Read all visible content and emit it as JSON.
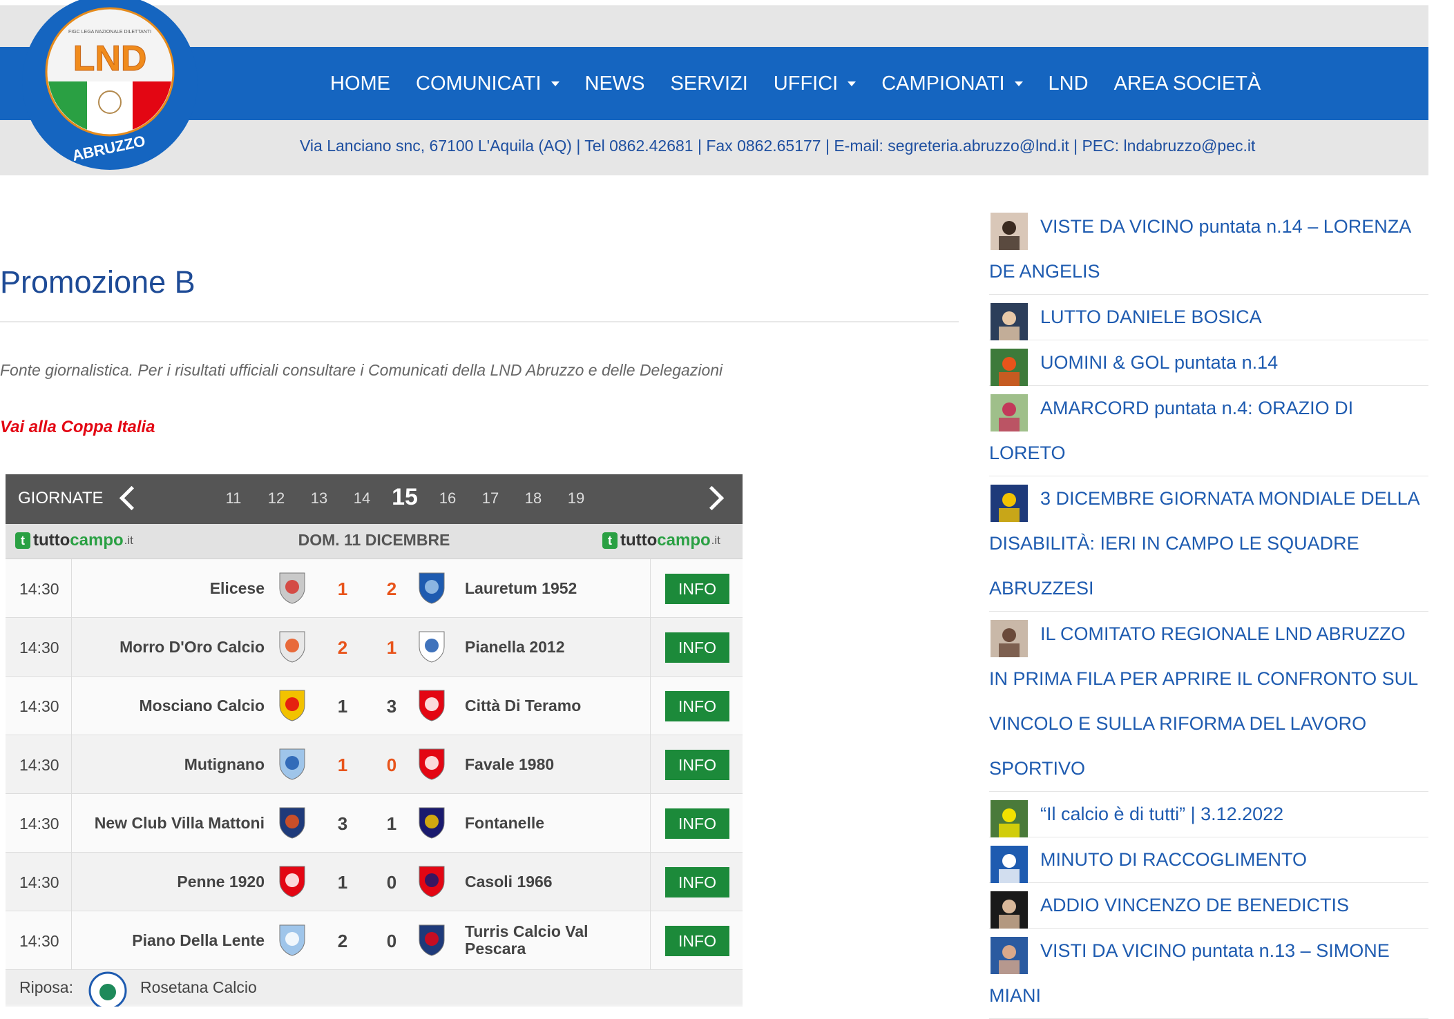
{
  "nav": {
    "items": [
      {
        "label": "HOME",
        "dropdown": false
      },
      {
        "label": "COMUNICATI",
        "dropdown": true
      },
      {
        "label": "NEWS",
        "dropdown": false
      },
      {
        "label": "SERVIZI",
        "dropdown": false
      },
      {
        "label": "UFFICI",
        "dropdown": true
      },
      {
        "label": "CAMPIONATI",
        "dropdown": true
      },
      {
        "label": "LND",
        "dropdown": false
      },
      {
        "label": "AREA SOCIETÀ",
        "dropdown": false
      }
    ]
  },
  "logo": {
    "top_text": "FIGC LEGA NAZIONALE DILETTANTI",
    "main": "LND",
    "region": "ABRUZZO"
  },
  "contact": "Via Lanciano snc, 67100 L'Aquila (AQ) | Tel 0862.42681 | Fax 0862.65177 | E-mail: segreteria.abruzzo@lnd.it | PEC: lndabruzzo@pec.it",
  "page": {
    "title": "Promozione B",
    "note": "Fonte giornalistica. Per i risultati ufficiali consultare i Comunicati della LND Abruzzo e delle Delegazioni",
    "coppa_link": "Vai alla Coppa Italia"
  },
  "widget": {
    "label": "GIORNATE",
    "days": [
      "11",
      "12",
      "13",
      "14",
      "15",
      "16",
      "17",
      "18",
      "19"
    ],
    "current_day": "15",
    "date": "DOM. 11 DICEMBRE",
    "brand": {
      "a": "tutto",
      "b": "campo",
      "c": ".it",
      "mark": "t"
    },
    "info_label": "INFO",
    "rest_label": "Riposa:",
    "rest_team": "Rosetana Calcio",
    "colors": {
      "win": "#e8541b",
      "normal": "#444444",
      "info": "#1c8a3a",
      "bar": "#555555"
    },
    "matches": [
      {
        "time": "14:30",
        "home": "Elicese",
        "home_score": "1",
        "away_score": "2",
        "away": "Lauretum 1952",
        "home_highlight": true,
        "away_highlight": true
      },
      {
        "time": "14:30",
        "home": "Morro D'Oro Calcio",
        "home_score": "2",
        "away_score": "1",
        "away": "Pianella 2012",
        "home_highlight": true,
        "away_highlight": true
      },
      {
        "time": "14:30",
        "home": "Mosciano Calcio",
        "home_score": "1",
        "away_score": "3",
        "away": "Città Di Teramo",
        "home_highlight": false,
        "away_highlight": false
      },
      {
        "time": "14:30",
        "home": "Mutignano",
        "home_score": "1",
        "away_score": "0",
        "away": "Favale 1980",
        "home_highlight": true,
        "away_highlight": true
      },
      {
        "time": "14:30",
        "home": "New Club Villa Mattoni",
        "home_score": "3",
        "away_score": "1",
        "away": "Fontanelle",
        "home_highlight": false,
        "away_highlight": false
      },
      {
        "time": "14:30",
        "home": "Penne 1920",
        "home_score": "1",
        "away_score": "0",
        "away": "Casoli 1966",
        "home_highlight": false,
        "away_highlight": false
      },
      {
        "time": "14:30",
        "home": "Piano Della Lente",
        "home_score": "2",
        "away_score": "0",
        "away": "Turris Calcio Val Pescara",
        "home_highlight": false,
        "away_highlight": false
      }
    ]
  },
  "sidebar": {
    "news": [
      {
        "title": "VISTE DA VICINO puntata n.14 – LORENZA DE ANGELIS",
        "thumb": "portrait"
      },
      {
        "title": "LUTTO DANIELE BOSICA",
        "thumb": "player"
      },
      {
        "title": "UOMINI & GOL puntata n.14",
        "thumb": "players"
      },
      {
        "title": "AMARCORD puntata n.4: ORAZIO DI LORETO",
        "thumb": "team-photo"
      },
      {
        "title": "3 DICEMBRE GIORNATA MONDIALE DELLA DISABILITÀ: IERI IN CAMPO LE SQUADRE ABRUZZESI",
        "thumb": "event"
      },
      {
        "title": "IL COMITATO REGIONALE LND ABRUZZO IN PRIMA FILA PER APRIRE IL CONFRONTO SUL VINCOLO E SULLA RIFORMA DEL LAVORO SPORTIVO",
        "thumb": "conference"
      },
      {
        "title": "“Il calcio è di tutti” | 3.12.2022",
        "thumb": "match"
      },
      {
        "title": "MINUTO DI RACCOGLIMENTO",
        "thumb": "lnd-logo"
      },
      {
        "title": "ADDIO VINCENZO DE BENEDICTIS",
        "thumb": "portrait-dark"
      },
      {
        "title": "VISTI DA VICINO puntata n.13 – SIMONE MIANI",
        "thumb": "referee"
      }
    ]
  }
}
